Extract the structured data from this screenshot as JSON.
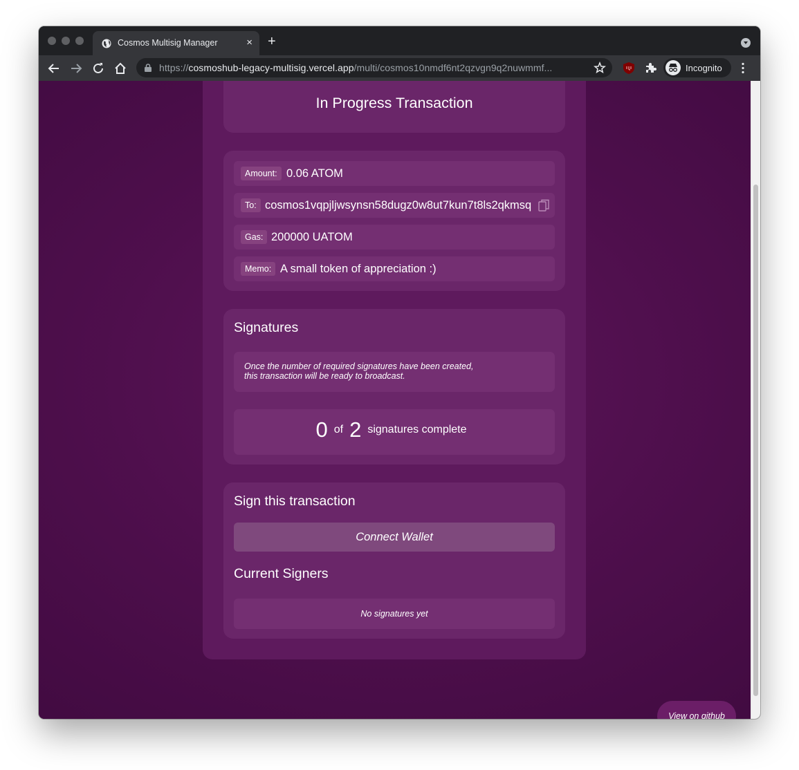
{
  "browser": {
    "tab_title": "Cosmos Multisig Manager",
    "tab_close": "×",
    "new_tab": "+",
    "url_scheme": "https://",
    "url_host": "cosmoshub-legacy-multisig.vercel.app",
    "url_path": "/multi/cosmos10nmdf6nt2qzvgn9q2nuwmmf...",
    "profile_label": "Incognito"
  },
  "page": {
    "title": "In Progress Transaction",
    "details": {
      "amount_label": "Amount:",
      "amount_value": "0.06 ATOM",
      "to_label": "To:",
      "to_value": "cosmos1vqpjljwsynsn58dugz0w8ut7kun7t8ls2qkmsq",
      "gas_label": "Gas:",
      "gas_value": "200000 UATOM",
      "memo_label": "Memo:",
      "memo_value": "A small token of appreciation :)"
    },
    "signatures": {
      "heading": "Signatures",
      "notice_line1": "Once the number of required signatures have been created,",
      "notice_line2": "this transaction will be ready to broadcast.",
      "current": "0",
      "of_word": "of",
      "required": "2",
      "complete_text": "signatures complete"
    },
    "sign": {
      "heading": "Sign this transaction",
      "connect_label": "Connect Wallet",
      "signers_heading": "Current Signers",
      "no_signatures": "No signatures yet"
    },
    "github_link": "View on github"
  },
  "colors": {
    "bg_dark": "#3f0a3f",
    "bg_mid": "#5c1659",
    "card_outer": "#5e1a5d",
    "card_inner": "#6a2669",
    "row": "#742f72",
    "button": "#7f497d"
  }
}
